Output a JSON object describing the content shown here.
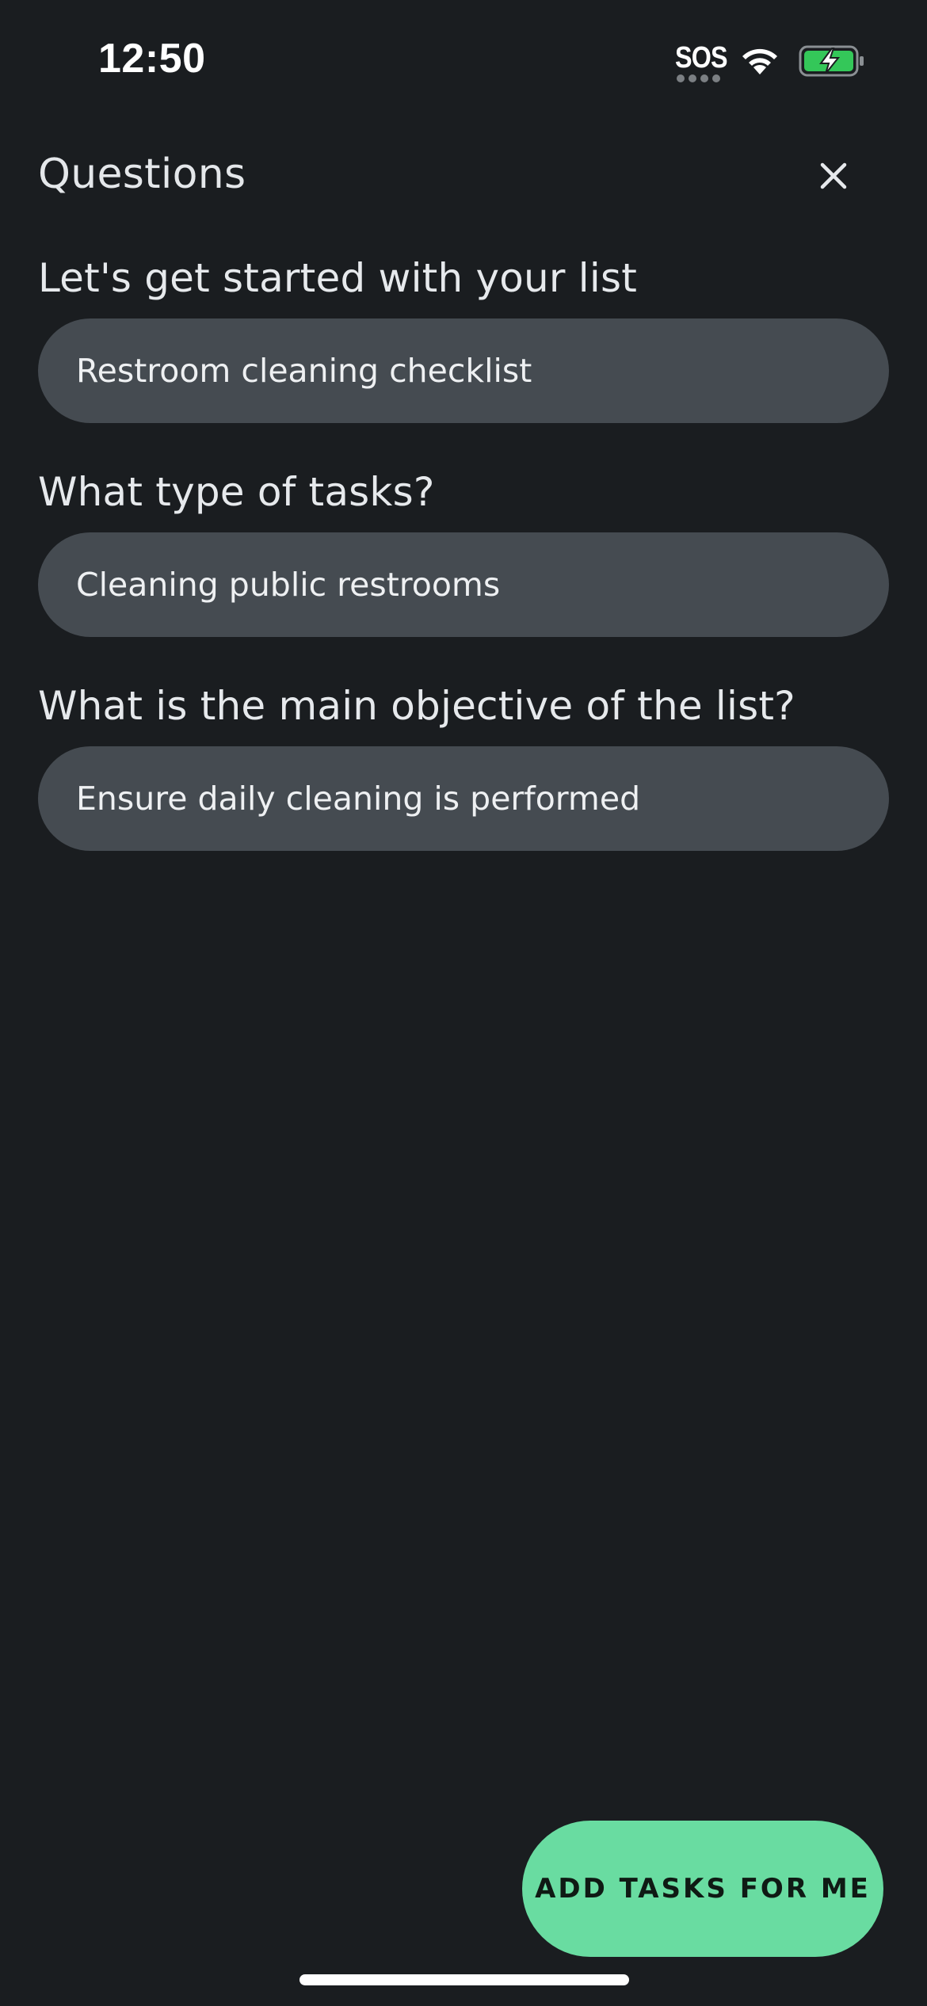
{
  "status_bar": {
    "time": "12:50",
    "sos_label": "SOS",
    "battery_accent": "#34c759"
  },
  "header": {
    "title": "Questions",
    "close_icon": "close-icon"
  },
  "questions": [
    {
      "label": "Let's get started with your list",
      "value": "Restroom cleaning checklist"
    },
    {
      "label": "What type of tasks?",
      "value": "Cleaning public restrooms"
    },
    {
      "label": "What is the main objective of the list?",
      "value": "Ensure daily cleaning is performed"
    }
  ],
  "action": {
    "label": "ADD TASKS FOR ME",
    "color": "#69dca1"
  },
  "theme": {
    "background": "#1a1d20",
    "field_background": "#454b51"
  }
}
